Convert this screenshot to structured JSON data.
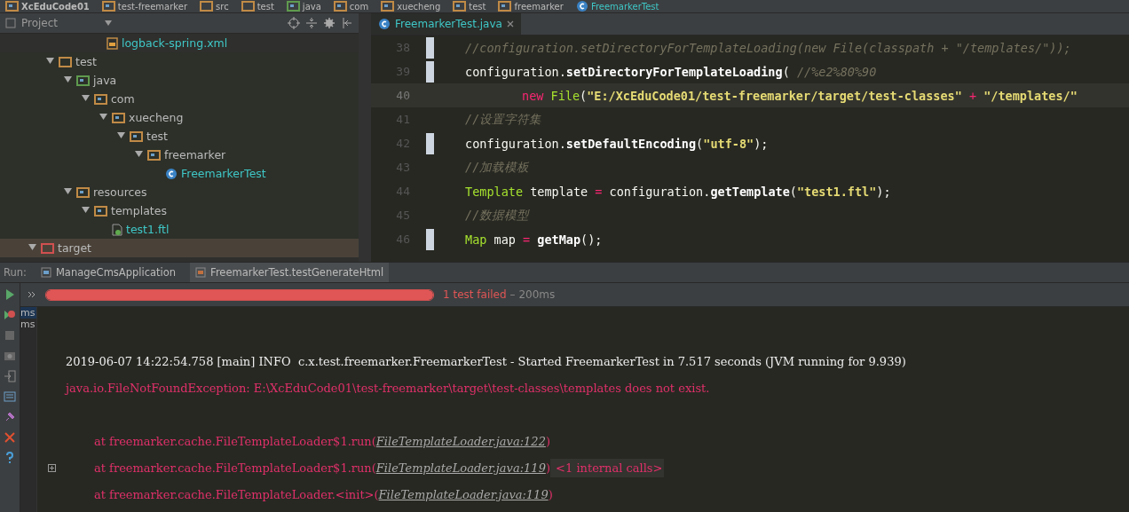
{
  "breadcrumb": [
    {
      "label": "XcEduCode01",
      "kind": "project"
    },
    {
      "label": "test-freemarker",
      "kind": "module"
    },
    {
      "label": "src",
      "kind": "folder"
    },
    {
      "label": "test",
      "kind": "folder"
    },
    {
      "label": "java",
      "kind": "source"
    },
    {
      "label": "com",
      "kind": "package"
    },
    {
      "label": "xuecheng",
      "kind": "package"
    },
    {
      "label": "test",
      "kind": "package"
    },
    {
      "label": "freemarker",
      "kind": "package"
    },
    {
      "label": "FreemarkerTest",
      "kind": "class"
    }
  ],
  "project_panel": {
    "title": "Project",
    "continued_item": {
      "label": "logback-spring.xml",
      "kind": "xml"
    },
    "tree": [
      {
        "label": "test",
        "kind": "folder",
        "expanded": true,
        "children": [
          {
            "label": "java",
            "kind": "source",
            "expanded": true,
            "children": [
              {
                "label": "com",
                "kind": "package",
                "expanded": true,
                "children": [
                  {
                    "label": "xuecheng",
                    "kind": "package",
                    "expanded": true,
                    "children": [
                      {
                        "label": "test",
                        "kind": "package",
                        "expanded": true,
                        "children": [
                          {
                            "label": "freemarker",
                            "kind": "package",
                            "expanded": true,
                            "children": [
                              {
                                "label": "FreemarkerTest",
                                "kind": "class"
                              }
                            ]
                          }
                        ]
                      }
                    ]
                  }
                ]
              }
            ]
          },
          {
            "label": "resources",
            "kind": "resources",
            "expanded": true,
            "children": [
              {
                "label": "templates",
                "kind": "package",
                "expanded": true,
                "children": [
                  {
                    "label": "test1.ftl",
                    "kind": "ftl"
                  }
                ]
              }
            ]
          }
        ]
      },
      {
        "label": "target",
        "kind": "excluded",
        "expanded": true
      }
    ]
  },
  "editor": {
    "tabs": [
      {
        "label": "FreemarkerTest.java",
        "selected": true
      }
    ],
    "lines": [
      {
        "number": "38",
        "current": false,
        "changed": true,
        "segments": [
          {
            "kind": "comment",
            "text": "//configuration.setDirectoryForTemplateLoading(new File(classpath + \"/templates/\"));"
          }
        ]
      },
      {
        "number": "39",
        "current": false,
        "changed": true,
        "segments": [
          {
            "kind": "plain",
            "text": "configuration."
          },
          {
            "kind": "method",
            "text": "setDirectoryForTemplateLoading"
          },
          {
            "kind": "plain",
            "text": "( "
          },
          {
            "kind": "comment",
            "text": "//%e2%80%90"
          }
        ]
      },
      {
        "number": "40",
        "current": true,
        "changed": false,
        "indent": true,
        "segments": [
          {
            "kind": "keyword",
            "text": "new "
          },
          {
            "kind": "type",
            "text": "File"
          },
          {
            "kind": "plain",
            "text": "("
          },
          {
            "kind": "string",
            "text": "\"E:/XcEduCode01/test-freemarker/target/test-classes\""
          },
          {
            "kind": "keyword",
            "text": " + "
          },
          {
            "kind": "string",
            "text": "\"/templates/\""
          }
        ]
      },
      {
        "number": "41",
        "current": false,
        "changed": false,
        "segments": [
          {
            "kind": "comment",
            "text": "//设置字符集"
          }
        ]
      },
      {
        "number": "42",
        "current": false,
        "changed": true,
        "segments": [
          {
            "kind": "plain",
            "text": "configuration."
          },
          {
            "kind": "method",
            "text": "setDefaultEncoding"
          },
          {
            "kind": "plain",
            "text": "("
          },
          {
            "kind": "string",
            "text": "\"utf-8\""
          },
          {
            "kind": "plain",
            "text": ");"
          }
        ]
      },
      {
        "number": "43",
        "current": false,
        "changed": false,
        "segments": [
          {
            "kind": "comment",
            "text": "//加载模板"
          }
        ]
      },
      {
        "number": "44",
        "current": false,
        "changed": false,
        "segments": [
          {
            "kind": "type",
            "text": "Template"
          },
          {
            "kind": "plain",
            "text": " template "
          },
          {
            "kind": "keyword",
            "text": "="
          },
          {
            "kind": "plain",
            "text": " configuration."
          },
          {
            "kind": "method",
            "text": "getTemplate"
          },
          {
            "kind": "plain",
            "text": "("
          },
          {
            "kind": "string",
            "text": "\"test1.ftl\""
          },
          {
            "kind": "plain",
            "text": ");"
          }
        ]
      },
      {
        "number": "45",
        "current": false,
        "changed": false,
        "segments": [
          {
            "kind": "comment",
            "text": "//数据模型"
          }
        ]
      },
      {
        "number": "46",
        "current": false,
        "changed": true,
        "segments": [
          {
            "kind": "type",
            "text": "Map"
          },
          {
            "kind": "plain",
            "text": " map "
          },
          {
            "kind": "keyword",
            "text": "= "
          },
          {
            "kind": "method",
            "text": "getMap"
          },
          {
            "kind": "plain",
            "text": "();"
          }
        ]
      }
    ]
  },
  "run_panel": {
    "label": "Run:",
    "tabs": [
      {
        "label": "ManageCmsApplication",
        "selected": false
      },
      {
        "label": "FreemarkerTest.testGenerateHtml",
        "selected": true
      }
    ],
    "progress": {
      "level": 1,
      "failed": true,
      "status": "1 test failed",
      "duration": "– 200ms"
    },
    "tree_items": [
      "ms",
      "ms"
    ],
    "console": [
      {
        "kind": "info",
        "text": "2019-06-07 14:22:54.758 [main] INFO  c.x.test.freemarker.FreemarkerTest - Started FreemarkerTest in 7.517 seconds (JVM running for 9.939)"
      },
      {
        "kind": "error",
        "text": "java.io.FileNotFoundException: E:\\XcEduCode01\\test-freemarker\\target\\test-classes\\templates does not exist."
      },
      {
        "kind": "blank"
      },
      {
        "kind": "stack",
        "text": "at freemarker.cache.FileTemplateLoader$1.run(",
        "link": "FileTemplateLoader.java:122",
        "after": ")"
      },
      {
        "kind": "stack",
        "expandable": true,
        "text": "at freemarker.cache.FileTemplateLoader$1.run(",
        "link": "FileTemplateLoader.java:119",
        "after": ")",
        "folded": "<1 internal calls>"
      },
      {
        "kind": "stack",
        "text": "at freemarker.cache.FileTemplateLoader.<init>(",
        "link": "FileTemplateLoader.java:119",
        "after": ")"
      }
    ]
  }
}
